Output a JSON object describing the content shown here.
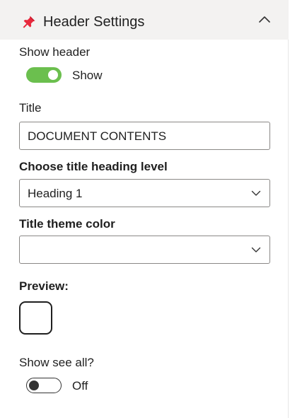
{
  "header": {
    "title": "Header Settings",
    "icon": "pin-icon",
    "collapse_icon": "chevron-up-icon",
    "pin_color": "#e8283c"
  },
  "show_header": {
    "label": "Show header",
    "state": "on",
    "state_label": "Show",
    "toggle_color": "#6bbf4e"
  },
  "title_field": {
    "label": "Title",
    "value": "DOCUMENT CONTENTS"
  },
  "heading_level": {
    "label": "Choose title heading level",
    "selected": "Heading 1"
  },
  "theme_color": {
    "label": "Title theme color",
    "selected": ""
  },
  "preview": {
    "label": "Preview:"
  },
  "see_all": {
    "label": "Show see all?",
    "state": "off",
    "state_label": "Off"
  }
}
